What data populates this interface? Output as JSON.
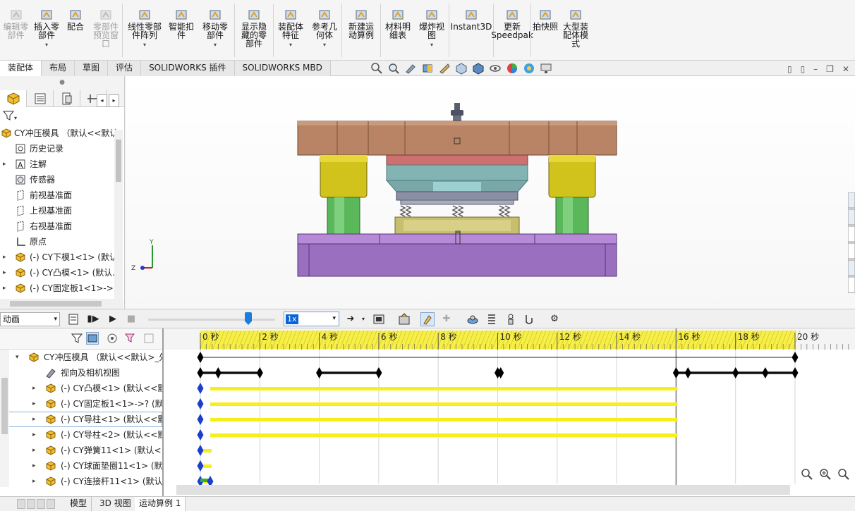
{
  "ribbon": {
    "buttons": [
      {
        "label": "编辑零\n部件",
        "disabled": true,
        "icon": "edit-component-icon"
      },
      {
        "label": "插入零\n部件",
        "disabled": false,
        "icon": "insert-component-icon",
        "dropdown": true
      },
      {
        "label": "配合",
        "disabled": false,
        "icon": "mate-icon"
      },
      {
        "label": "零部件\n预览窗\n口",
        "disabled": true,
        "icon": "preview-window-icon"
      },
      {
        "label": "线性零部\n件阵列",
        "disabled": false,
        "icon": "linear-pattern-icon",
        "dropdown": true
      },
      {
        "label": "智能扣\n件",
        "disabled": false,
        "icon": "smart-fastener-icon"
      },
      {
        "label": "移动零\n部件",
        "disabled": false,
        "icon": "move-component-icon",
        "dropdown": true
      },
      {
        "label": "显示隐\n藏的零\n部件",
        "disabled": false,
        "icon": "show-hidden-icon"
      },
      {
        "label": "装配体\n特征",
        "disabled": false,
        "icon": "assembly-feature-icon",
        "dropdown": true
      },
      {
        "label": "参考几\n何体",
        "disabled": false,
        "icon": "reference-geometry-icon",
        "dropdown": true
      },
      {
        "label": "新建运\n动算例",
        "disabled": false,
        "icon": "new-motion-study-icon"
      },
      {
        "label": "材料明\n细表",
        "disabled": false,
        "icon": "bom-icon"
      },
      {
        "label": "爆炸视\n图",
        "disabled": false,
        "icon": "exploded-view-icon",
        "dropdown": true
      },
      {
        "label": "Instant3D",
        "disabled": false,
        "icon": "instant3d-icon"
      },
      {
        "label": "更新\nSpeedpak",
        "disabled": false,
        "icon": "speedpak-icon"
      },
      {
        "label": "拍快照",
        "disabled": false,
        "icon": "snapshot-icon"
      },
      {
        "label": "大型装\n配体模\n式",
        "disabled": false,
        "icon": "large-assembly-icon"
      }
    ]
  },
  "tabs": [
    "装配体",
    "布局",
    "草图",
    "评估",
    "SOLIDWORKS 插件",
    "SOLIDWORKS MBD"
  ],
  "active_tab": "装配体",
  "feature_tree": {
    "root": "CY冲压模具 （默认<<默认",
    "items": [
      {
        "label": "历史记录",
        "icon": "history-icon",
        "expand": false
      },
      {
        "label": "注解",
        "icon": "annotation-icon",
        "expand": true
      },
      {
        "label": "传感器",
        "icon": "sensor-icon",
        "expand": false
      },
      {
        "label": "前视基准面",
        "icon": "plane-icon",
        "expand": false
      },
      {
        "label": "上视基准面",
        "icon": "plane-icon",
        "expand": false
      },
      {
        "label": "右视基准面",
        "icon": "plane-icon",
        "expand": false
      },
      {
        "label": "原点",
        "icon": "origin-icon",
        "expand": false
      },
      {
        "label": "(-) CY下模1<1> (默认",
        "icon": "part-icon",
        "expand": true
      },
      {
        "label": "(-) CY凸模<1> (默认..",
        "icon": "part-icon",
        "expand": true
      },
      {
        "label": "(-) CY固定板1<1>->",
        "icon": "part-icon",
        "expand": true
      }
    ]
  },
  "motion": {
    "study_type": "动画",
    "speed": "1x",
    "time_labels": [
      "0 秒",
      "2 秒",
      "4 秒",
      "6 秒",
      "8 秒",
      "10 秒",
      "12 秒",
      "14 秒",
      "16 秒",
      "18 秒",
      "20 秒"
    ],
    "tree": [
      {
        "label": "CY冲压模具 （默认<<默认>_外",
        "icon": "assembly-icon",
        "indent": 0,
        "expand": "down"
      },
      {
        "label": "视向及相机视图",
        "icon": "camera-icon",
        "indent": 1,
        "expand": "none"
      },
      {
        "label": "(-) CY凸模<1> (默认<<默",
        "icon": "part-icon",
        "indent": 1,
        "expand": "right"
      },
      {
        "label": "(-) CY固定板1<1>->? (默",
        "icon": "part-icon",
        "indent": 1,
        "expand": "right"
      },
      {
        "label": "(-) CY导柱<1> (默认<<默",
        "icon": "part-icon",
        "indent": 1,
        "expand": "right"
      },
      {
        "label": "(-) CY导柱<2> (默认<<默",
        "icon": "part-icon",
        "indent": 1,
        "expand": "right"
      },
      {
        "label": "(-) CY弹簧11<1> (默认<<",
        "icon": "part-icon",
        "indent": 1,
        "expand": "right"
      },
      {
        "label": "(-) CY球面垫圈11<1> (默",
        "icon": "part-icon",
        "indent": 1,
        "expand": "right"
      },
      {
        "label": "(-) CY连接杆11<1> (默认",
        "icon": "part-icon",
        "indent": 1,
        "expand": "right"
      }
    ],
    "keyframe_times_assembly": [
      0,
      20
    ],
    "keyframe_times_camera": [
      0,
      0.6,
      2,
      4,
      6,
      10,
      10.1,
      16,
      16.4,
      18,
      19,
      20
    ],
    "playhead_time": 16
  },
  "bottom_tabs": [
    "模型",
    "3D 视图",
    "运动算例 1"
  ],
  "active_bottom_tab": "运动算例 1"
}
